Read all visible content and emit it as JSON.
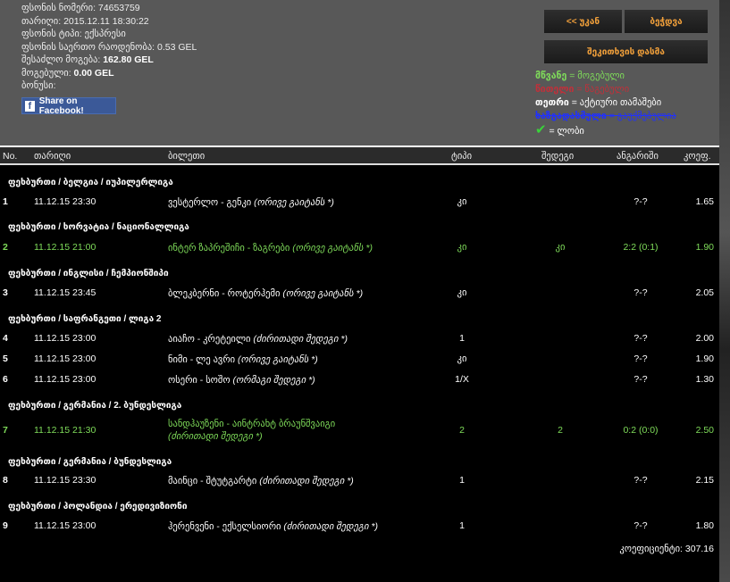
{
  "info": {
    "bet_number_label": "ფსონის ნომერი:",
    "bet_number": "74653759",
    "date_label": "თარიღი:",
    "date": "2015.12.11 18:30:22",
    "bet_type_label": "ფსონის ტიპი:",
    "bet_type": "ექსპრესი",
    "total_stake_label": "ფსონის საერთო რაოდენობა:",
    "total_stake": "0.53 GEL",
    "possible_win_label": "შესაძლო მოგება:",
    "possible_win": "162.80 GEL",
    "won_label": "მოგებული:",
    "won": "0.00 GEL",
    "bonus_label": "ბონუსი:"
  },
  "facebook_label": "Share on Facebook!",
  "buttons": {
    "back": "<< უკან",
    "print": "ბეჭდვა",
    "ask": "შეკითხვის დასმა"
  },
  "legend": [
    {
      "key": "მწვანე",
      "text": "= მოგებული",
      "color": "#7fdc5a"
    },
    {
      "key": "წითელი",
      "text": "= წაგებული",
      "color": "#c0303a"
    },
    {
      "key": "თეთრი",
      "text": "= აქტიური თამაშები",
      "color": "#ffffff"
    },
    {
      "key": "ხაზგადასმული",
      "text": "= გაუქმებულია",
      "color": "#2030ff"
    },
    {
      "key": "✔",
      "text": "= ლობი",
      "color": "#3ad23a"
    }
  ],
  "headers": {
    "no": "No.",
    "date": "თარიღი",
    "ticket": "ბილეთი",
    "type": "ტიპი",
    "result": "შედეგი",
    "score": "ანგარიში",
    "coef": "კოეფ."
  },
  "rows": [
    {
      "group": "ფეხბურთი / ბელგია / იუპილერლიგა",
      "no": "1",
      "date": "11.12.15 23:30",
      "match": "ვესტერლო - გენკი",
      "market": "(ორივე გაიტანს *)",
      "type": "კი",
      "result": "",
      "score": "?-?",
      "coef": "1.65",
      "won": false
    },
    {
      "group": "ფეხბურთი / ხორვატია / ნაციონალლიგა",
      "no": "2",
      "date": "11.12.15 21:00",
      "match": "ინტერ ზაპრეშიჩი - ზაგრები",
      "market": "(ორივე გაიტანს *)",
      "type": "კი",
      "result": "კი",
      "score": "2:2 (0:1)",
      "coef": "1.90",
      "won": true
    },
    {
      "group": "ფეხბურთი / ინგლისი / ჩემპიონშიპი",
      "no": "3",
      "date": "11.12.15 23:45",
      "match": "ბლეკბერნი - როტერჰემი",
      "market": "(ორივე გაიტანს *)",
      "type": "კი",
      "result": "",
      "score": "?-?",
      "coef": "2.05",
      "won": false
    },
    {
      "group": "ფეხბურთი / საფრანგეთი / ლიგა 2",
      "no": "4",
      "date": "11.12.15 23:00",
      "match": "აიაჩო - კრეტეილი",
      "market": "(ძირითადი შედეგი *)",
      "type": "1",
      "result": "",
      "score": "?-?",
      "coef": "2.00",
      "won": false
    },
    {
      "group": "",
      "no": "5",
      "date": "11.12.15 23:00",
      "match": "ნიმი - ლე ავრი",
      "market": "(ორივე გაიტანს *)",
      "type": "კი",
      "result": "",
      "score": "?-?",
      "coef": "1.90",
      "won": false
    },
    {
      "group": "",
      "no": "6",
      "date": "11.12.15 23:00",
      "match": "ოსერი - სოშო",
      "market": "(ორმაგი შედეგი *)",
      "type": "1/X",
      "result": "",
      "score": "?-?",
      "coef": "1.30",
      "won": false
    },
    {
      "group": "ფეხბურთი / გერმანია / 2. ბუნდესლიგა",
      "no": "7",
      "date": "11.12.15 21:30",
      "match": "სანდჰაუზენი - აინტრახტ ბრაუნშვაიგი",
      "market": "(ძირითადი შედეგი *)",
      "type": "2",
      "result": "2",
      "score": "0:2 (0:0)",
      "coef": "2.50",
      "won": true
    },
    {
      "group": "ფეხბურთი / გერმანია / ბუნდესლიგა",
      "no": "8",
      "date": "11.12.15 23:30",
      "match": "მაინცი - შტუტგარტი",
      "market": "(ძირითადი შედეგი *)",
      "type": "1",
      "result": "",
      "score": "?-?",
      "coef": "2.15",
      "won": false
    },
    {
      "group": "ფეხბურთი / ჰოლანდია / ერედივიზიონი",
      "no": "9",
      "date": "11.12.15 23:00",
      "match": "ჰერენვენი - ექსელსიორი",
      "market": "(ძირითადი შედეგი *)",
      "type": "1",
      "result": "",
      "score": "?-?",
      "coef": "1.80",
      "won": false
    }
  ],
  "total_label": "კოეფიციენტი:",
  "total_value": "307.16"
}
